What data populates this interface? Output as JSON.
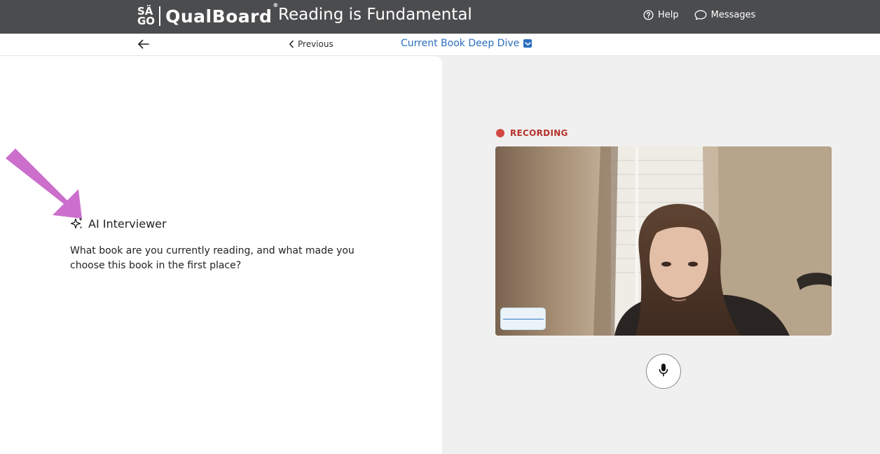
{
  "header": {
    "logo_small_top": "SÄ",
    "logo_small_bottom": "GO",
    "logo_text": "QualBoard",
    "logo_reg": "®",
    "page_title": "Reading is Fundamental",
    "help_label": "Help",
    "messages_label": "Messages"
  },
  "subnav": {
    "previous_label": "Previous",
    "section_label": "Current Book Deep Dive"
  },
  "interviewer": {
    "heading": "AI Interviewer",
    "question": "What book are you currently reading, and what made you choose this book in the first place?"
  },
  "recorder": {
    "status_label": "RECORDING"
  },
  "colors": {
    "header_bg": "#4b4c4e",
    "accent_blue": "#2a6fbf",
    "recording_red": "#d24a43",
    "annotation_arrow": "#cc6fcc"
  },
  "icons": {
    "back": "arrow-left-icon",
    "previous": "chevron-left-icon",
    "help": "question-circle-icon",
    "messages": "chat-bubble-icon",
    "ai": "sparkle-icon",
    "mic": "microphone-icon"
  }
}
